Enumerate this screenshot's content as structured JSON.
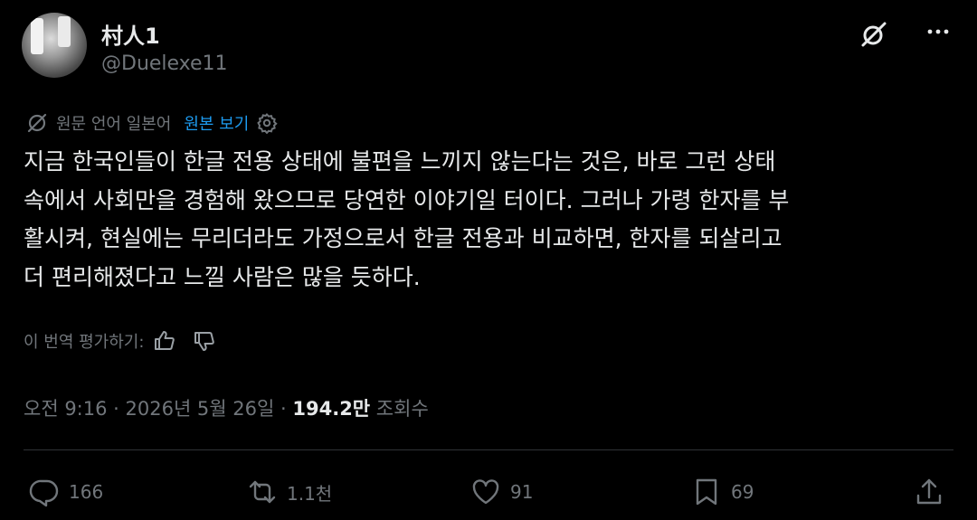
{
  "author": {
    "display_name": "村人1",
    "handle": "@Duelexe11"
  },
  "translation": {
    "original_language_label": "원문 언어 일본어",
    "show_original_label": "원본 보기"
  },
  "tweet": {
    "text": "지금 한국인들이 한글 전용 상태에 불편을 느끼지 않는다는 것은, 바로 그런 상태\n속에서 사회만을 경험해 왔으므로 당연한 이야기일 터이다. 그러나 가령 한자를 부\n활시켜, 현실에는 무리더라도 가정으로서 한글 전용과 비교하면, 한자를 되살리고\n더 편리해졌다고 느낄 사람은 많을 듯하다."
  },
  "rating": {
    "label": "이 번역 평가하기:"
  },
  "meta": {
    "timestamp": "오전 9:16 · 2026년 5월 26일 · ",
    "views_count": "194.2만",
    "views_label": " 조회수"
  },
  "actions": {
    "replies": "166",
    "reposts": "1.1천",
    "likes": "91",
    "bookmarks": "69"
  },
  "icons": [
    "grok-icon",
    "more-icon",
    "translate-icon",
    "gear-icon",
    "thumbs-up-icon",
    "thumbs-down-icon",
    "reply-icon",
    "repost-icon",
    "like-icon",
    "bookmark-icon",
    "share-icon"
  ],
  "colors": {
    "background": "#000000",
    "text": "#e7e9ea",
    "muted": "#71767b",
    "link": "#1d9bf0",
    "divider": "#2f3336"
  }
}
